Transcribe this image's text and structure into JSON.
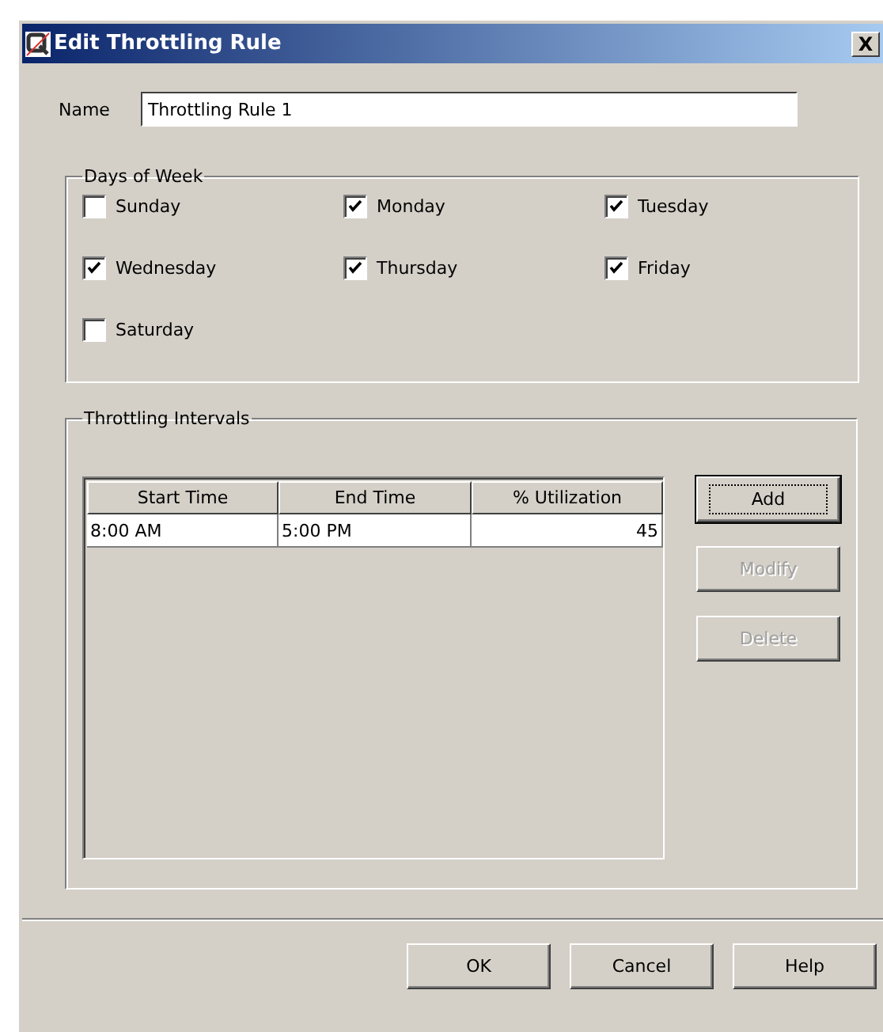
{
  "window": {
    "title": "Edit Throttling Rule",
    "close": "X"
  },
  "name_field": {
    "label": "Name",
    "value": "Throttling Rule 1"
  },
  "days_of_week": {
    "title": "Days of Week",
    "days": [
      {
        "label": "Sunday",
        "checked": false
      },
      {
        "label": "Monday",
        "checked": true
      },
      {
        "label": "Tuesday",
        "checked": true
      },
      {
        "label": "Wednesday",
        "checked": true
      },
      {
        "label": "Thursday",
        "checked": true
      },
      {
        "label": "Friday",
        "checked": true
      },
      {
        "label": "Saturday",
        "checked": false
      }
    ]
  },
  "throttling_intervals": {
    "title": "Throttling Intervals",
    "table": {
      "columns": [
        "Start Time",
        "End Time",
        "% Utilization"
      ],
      "rows": [
        [
          "8:00 AM",
          "5:00 PM",
          "45"
        ]
      ]
    },
    "buttons": [
      {
        "label": "Add",
        "disabled": false,
        "default": true
      },
      {
        "label": "Modify",
        "disabled": true,
        "default": false
      },
      {
        "label": "Delete",
        "disabled": true,
        "default": false
      }
    ]
  },
  "footer_buttons": [
    {
      "label": "OK",
      "disabled": false,
      "default": false
    },
    {
      "label": "Cancel",
      "disabled": false,
      "default": false
    },
    {
      "label": "Help",
      "disabled": false,
      "default": false
    }
  ]
}
